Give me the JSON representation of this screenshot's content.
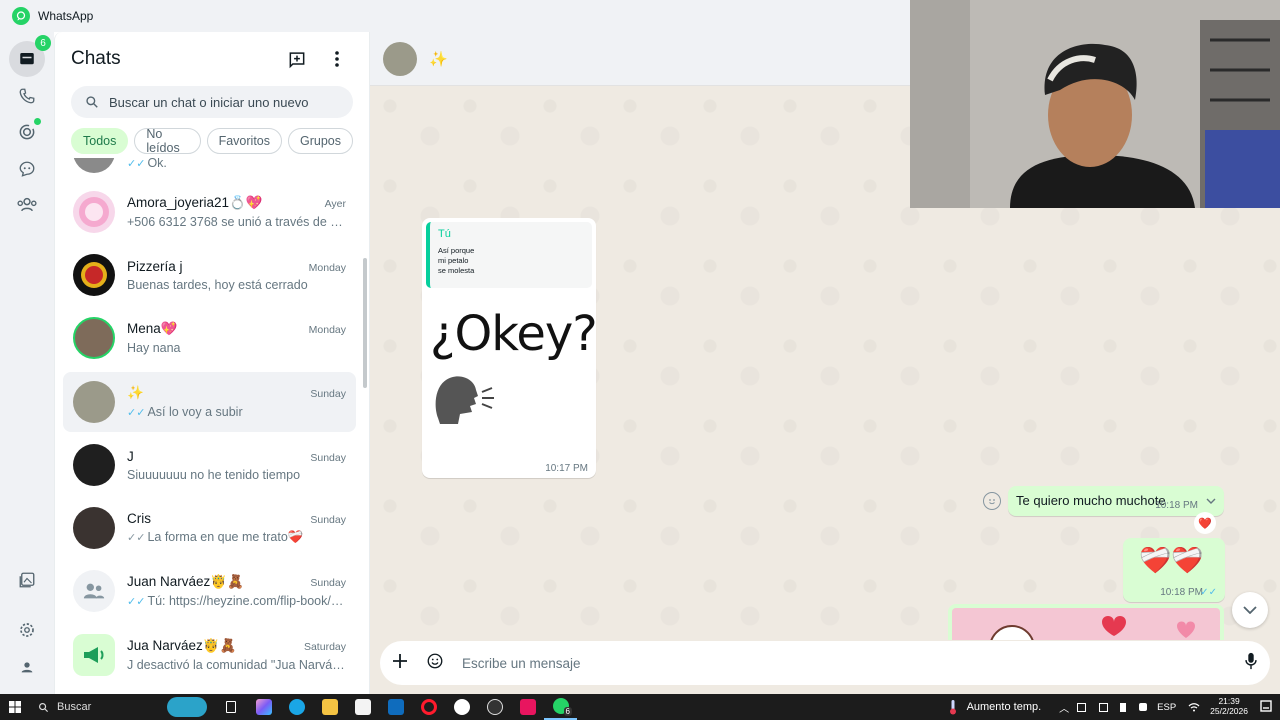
{
  "app": {
    "title": "WhatsApp"
  },
  "rail": {
    "chats_badge": "6",
    "status_dot": true
  },
  "chat_list": {
    "title": "Chats",
    "search_placeholder": "Buscar un chat o iniciar uno nuevo",
    "filters": [
      "Todos",
      "No leídos",
      "Favoritos",
      "Grupos"
    ],
    "partial_top_preview": "Ok.",
    "items": [
      {
        "name": "Amora_joyeria21💍💖",
        "time": "Ayer",
        "preview": "+506 6312 3768 se unió a través de u...",
        "ticks": ""
      },
      {
        "name": "Pizzería j",
        "time": "Monday",
        "preview": "Buenas tardes, hoy está cerrado",
        "ticks": ""
      },
      {
        "name": "Mena💖",
        "time": "Monday",
        "preview": "Hay nana",
        "ticks": ""
      },
      {
        "name": "✨",
        "time": "Sunday",
        "preview": "Así lo voy a subir",
        "ticks": "✓✓"
      },
      {
        "name": "J",
        "time": "Sunday",
        "preview": "Siuuuuuuu no he tenido tiempo",
        "ticks": ""
      },
      {
        "name": "Cris",
        "time": "Sunday",
        "preview": "La forma en que me trato❤️‍🩹",
        "ticks": "✓✓"
      },
      {
        "name": "Juan Narváez🤴🧸",
        "time": "Sunday",
        "preview": "Tú: https://heyzine.com/flip-book/6...",
        "ticks": "✓✓"
      },
      {
        "name": "Jua Narváez🤴🧸",
        "time": "Saturday",
        "preview": "J desactivó la comunidad \"Jua Narváe...",
        "ticks": ""
      }
    ]
  },
  "chat": {
    "contact_name": "✨",
    "quote_author": "Tú",
    "quote_text": "Así porque\n mi petalo\nse molesta",
    "sticker_text": "¿Okey?",
    "incoming_time": "10:17 PM",
    "out_message_1": "Te quiero mucho muchote",
    "out_time_1": "10:18 PM",
    "out_reaction_1": "❤️",
    "out_emoji_message": "❤️‍🩹❤️‍🩹",
    "out_time_2": "10:18 PM",
    "composer_placeholder": "Escribe un mensaje"
  },
  "taskbar": {
    "search": "Buscar",
    "weather": "Aumento temp.",
    "lang": "ESP",
    "time": "21:39",
    "date": "25/2/2026",
    "whatsapp_badge": "6"
  },
  "colors": {
    "accent": "#25d366",
    "outgoing_bubble": "#d9fdd3",
    "chat_bg": "#efeae2",
    "read_ticks": "#53bdeb"
  }
}
